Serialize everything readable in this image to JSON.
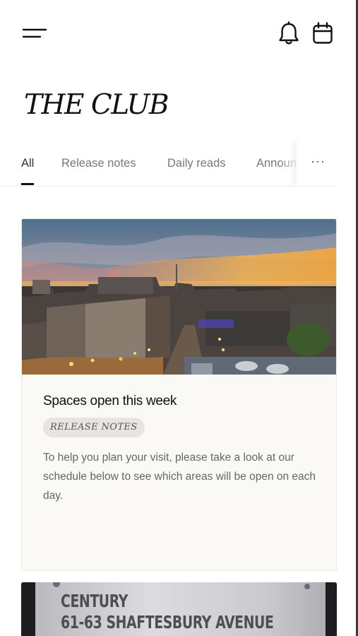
{
  "app": {
    "brand_title": "THE CLUB"
  },
  "header": {
    "menu_icon": "hamburger-menu-icon",
    "notification_icon": "bell-icon",
    "calendar_icon": "calendar-icon"
  },
  "tabs": [
    {
      "label": "All",
      "active": true
    },
    {
      "label": "Release notes",
      "active": false
    },
    {
      "label": "Daily reads",
      "active": false
    },
    {
      "label": "Announ",
      "active": false
    }
  ],
  "tabs_more_label": "···",
  "feed": {
    "cards": [
      {
        "title": "Spaces open this week",
        "category": "RELEASE NOTES",
        "excerpt": "To help you plan your visit, please take a look at our schedule below to see which areas will be open on each day."
      },
      {
        "sign_line_1": "CENTURY",
        "sign_line_2": "61-63 SHAFTESBURY AVENUE"
      }
    ]
  },
  "colors": {
    "text_primary": "#111111",
    "text_muted": "#777777",
    "card_bg": "#faf9f6",
    "badge_bg": "#e6e5e1",
    "accent_underline": "#111111"
  }
}
